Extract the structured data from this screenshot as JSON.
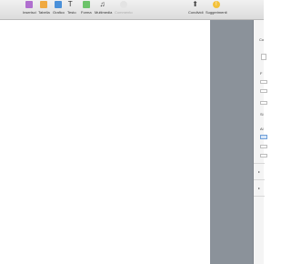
{
  "toolbar": {
    "insert_label": "Inserisci",
    "tables_label": "Tabella",
    "charts_label": "Grafico",
    "text_label": "Testo",
    "shapes_label": "Forma",
    "media_label": "Multimedia",
    "comment_label": "Commento",
    "share_label": "Condividi",
    "suggestions_label": "Suggerimenti",
    "text_glyph": "T",
    "media_glyph": "♫",
    "share_glyph": "⬆",
    "suggestions_glyph": "!",
    "colors": {
      "insert": "#b06fcf",
      "tables": "#f0a940",
      "charts": "#4a90d9",
      "shapes": "#6cc36a",
      "suggestions": "#f3c13a"
    }
  },
  "inspector": {
    "row1": "Co",
    "row2": "F",
    "row3": "Si",
    "row4": "Al",
    "arrow": "▸"
  }
}
